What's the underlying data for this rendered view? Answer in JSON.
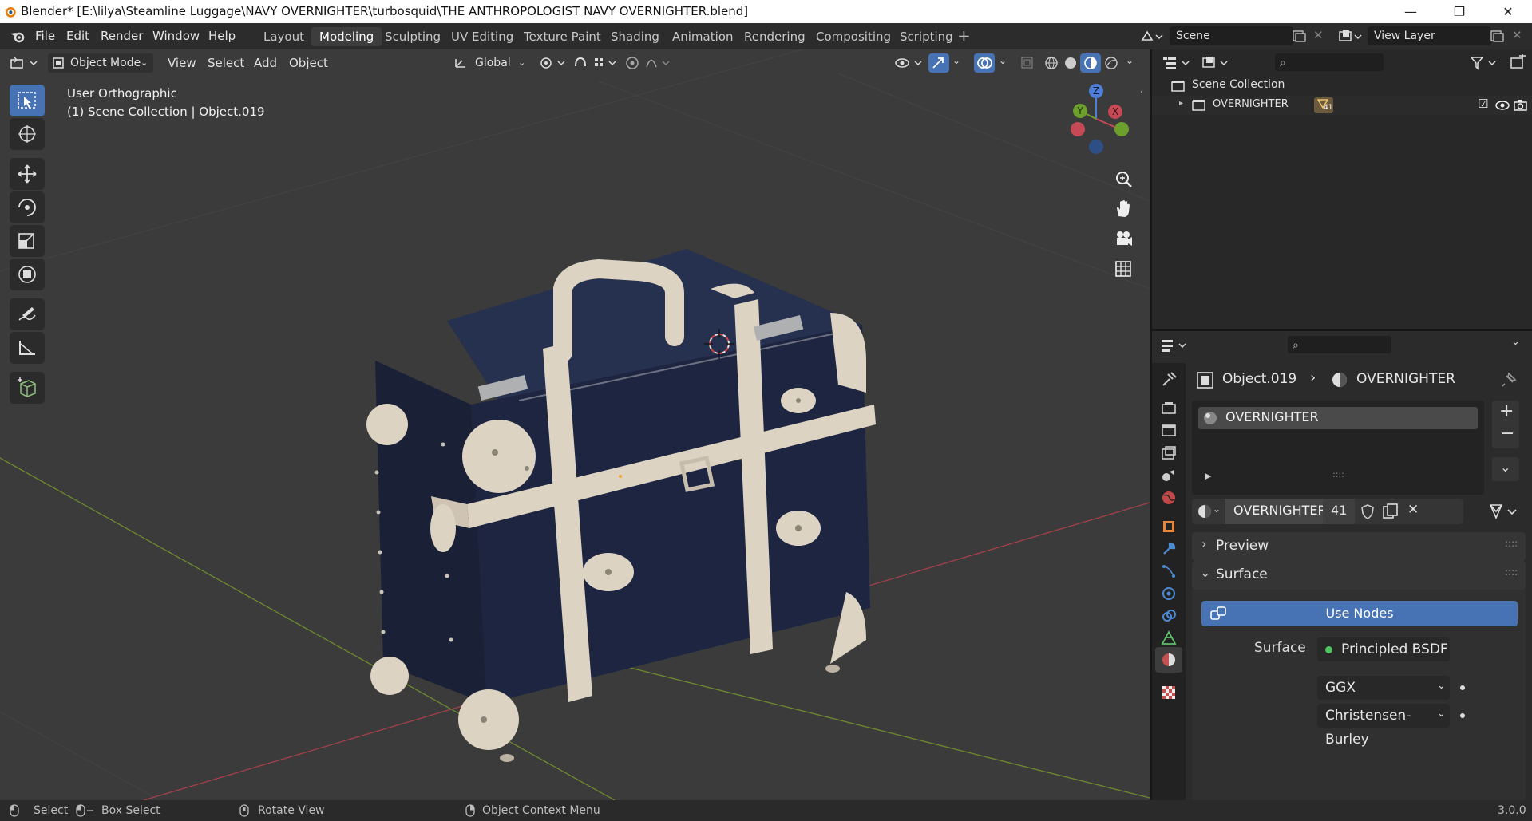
{
  "window": {
    "title": "Blender* [E:\\lilya\\Steamline Luggage\\NAVY OVERNIGHTER\\turbosquid\\THE ANTHROPOLOGIST NAVY OVERNIGHTER.blend]",
    "minimize": "—",
    "maximize": "❐",
    "close": "✕"
  },
  "menu": {
    "items": [
      "File",
      "Edit",
      "Render",
      "Window",
      "Help"
    ]
  },
  "workspaces": [
    "Layout",
    "Modeling",
    "Sculpting",
    "UV Editing",
    "Texture Paint",
    "Shading",
    "Animation",
    "Rendering",
    "Compositing",
    "Scripting"
  ],
  "active_workspace": "Modeling",
  "scene": {
    "label": "Scene"
  },
  "view_layer": {
    "label": "View Layer"
  },
  "viewport": {
    "mode": "Object Mode",
    "menus": [
      "View",
      "Select",
      "Add",
      "Object"
    ],
    "orientation": "Global",
    "view_name": "User Orthographic",
    "collection_info": "(1) Scene Collection | Object.019",
    "gizmo_axes": {
      "z": "Z",
      "y": "Y",
      "x": "X"
    }
  },
  "outliner": {
    "root": "Scene Collection",
    "items": [
      {
        "name": "OVERNIGHTER",
        "badge": "41"
      }
    ]
  },
  "properties": {
    "breadcrumb_object": "Object.019",
    "breadcrumb_material": "OVERNIGHTER",
    "material_slot": "OVERNIGHTER",
    "material_name": "OVERNIGHTER",
    "user_count": "41",
    "panels": {
      "preview": "Preview",
      "surface": "Surface"
    },
    "use_nodes": "Use Nodes",
    "surface_label": "Surface",
    "surface_value": "Principled BSDF",
    "distribution": "GGX",
    "subsurface_method": "Christensen-Burley"
  },
  "statusbar": {
    "select": "Select",
    "box_select": "Box Select",
    "rotate_view": "Rotate View",
    "context_menu": "Object Context Menu",
    "version": "3.0.0"
  },
  "colors": {
    "accent_blue": "#4772b3",
    "viewport_bg": "#3b3b3b",
    "case_navy": "#1e2540",
    "trim_cream": "#ddd3c3",
    "axis_red": "#a3414a",
    "axis_green": "#6c8a2e"
  }
}
